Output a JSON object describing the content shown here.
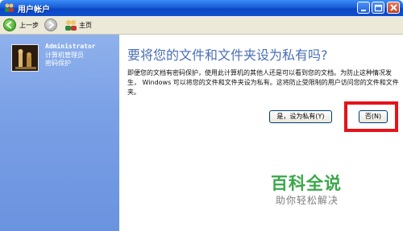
{
  "window": {
    "title": "用户帐户"
  },
  "toolbar": {
    "back_label": "上一步",
    "home_label": "主页"
  },
  "account": {
    "name": "Administrator",
    "role": "计算机管理员",
    "password_status": "密码保护"
  },
  "main": {
    "heading": "要将您的文件和文件夹设为私有吗?",
    "body": "即便您的文档有密码保护，使用此计算机的其他人还是可以看到您的文档。为防止这种情况发生， Windows 可以将您的文件和文件夹设为私有。这将防止受限制的用户访问您的文件和文件夹。",
    "yes_button": "是，设为私有(Y)",
    "no_button": "否(N)"
  },
  "watermark": {
    "title": "百科全说",
    "subtitle": "助你轻松解决"
  },
  "colors": {
    "highlight": "#e5131b",
    "heading": "#4a6fb5",
    "watermark": "#3aa74a"
  }
}
